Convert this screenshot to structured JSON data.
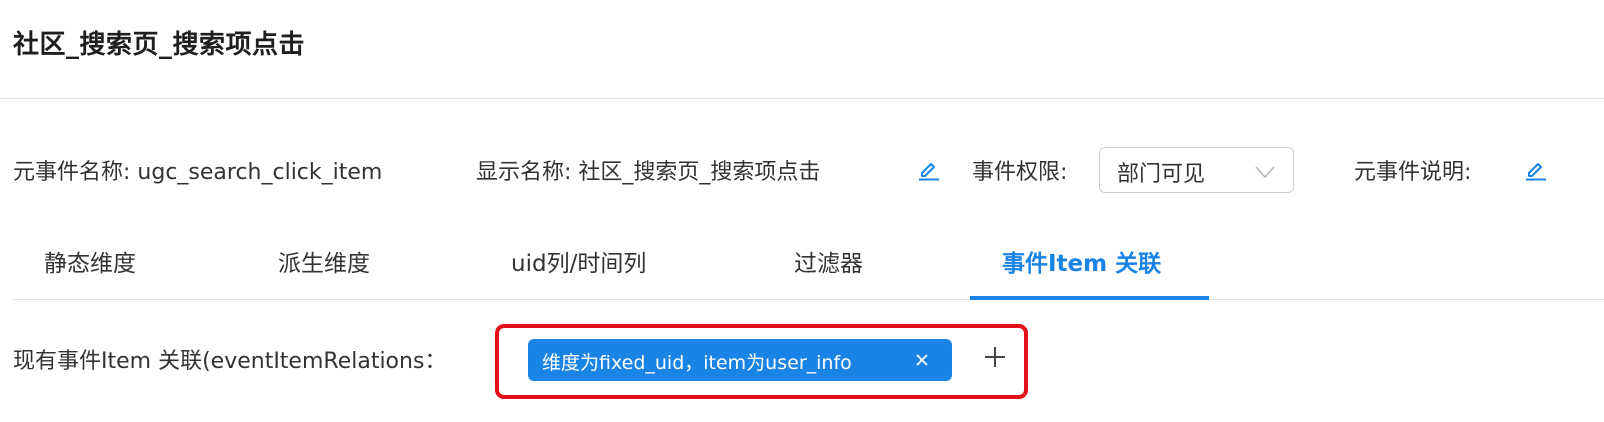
{
  "page": {
    "title": "社区_搜索页_搜索项点击"
  },
  "info": {
    "meta_event_name": "元事件名称: ugc_search_click_item",
    "display_name": "显示名称: 社区_搜索页_搜索项点击",
    "permission_label": "事件权限:",
    "permission_value": "部门可见",
    "description_label": "元事件说明:"
  },
  "tabs": [
    {
      "label": "静态维度"
    },
    {
      "label": "派生维度"
    },
    {
      "label": "uid列/时间列"
    },
    {
      "label": "过滤器"
    },
    {
      "label": "事件Item 关联"
    }
  ],
  "active_tab": "事件Item 关联",
  "relations": {
    "label": "现有事件Item 关联(eventItemRelations",
    "colon": "：",
    "tags": [
      {
        "text": "维度为fixed_uid，item为user_info"
      }
    ]
  },
  "colors": {
    "accent": "#1a84e6",
    "highlight": "#e5101a"
  },
  "icons": {
    "edit": "edit-icon",
    "chevron": "chevron-down-icon",
    "close": "close-icon",
    "add": "plus-icon"
  }
}
